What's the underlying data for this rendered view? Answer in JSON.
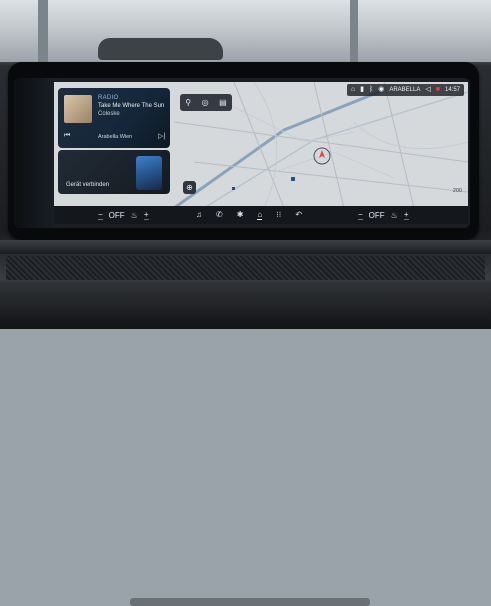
{
  "status_bar": {
    "station": "ARABELLA",
    "time": "14:57"
  },
  "media": {
    "source": "RADIO",
    "title": "Take Me Where The Sun",
    "artist": "Coleske",
    "station": "Arabella Wien",
    "prev_icon": "skip-back-icon",
    "next_icon": "skip-forward-icon"
  },
  "phone": {
    "label": "Gerät verbinden"
  },
  "map": {
    "tools": [
      "search-icon",
      "parking-icon",
      "bookmark-icon"
    ],
    "scale": "200"
  },
  "climate_left": {
    "minus": "−",
    "value": "OFF",
    "plus": "+"
  },
  "climate_right": {
    "minus": "−",
    "value": "OFF",
    "plus": "+"
  },
  "dock": {
    "items": [
      "music-icon",
      "phone-icon",
      "fan-icon",
      "home-icon",
      "apps-icon",
      "back-icon"
    ],
    "active_item": "home-icon"
  },
  "colors": {
    "accent_blue": "#3f7fe0",
    "accent_red": "#e0463f",
    "map_background": "#d6d9dc"
  }
}
